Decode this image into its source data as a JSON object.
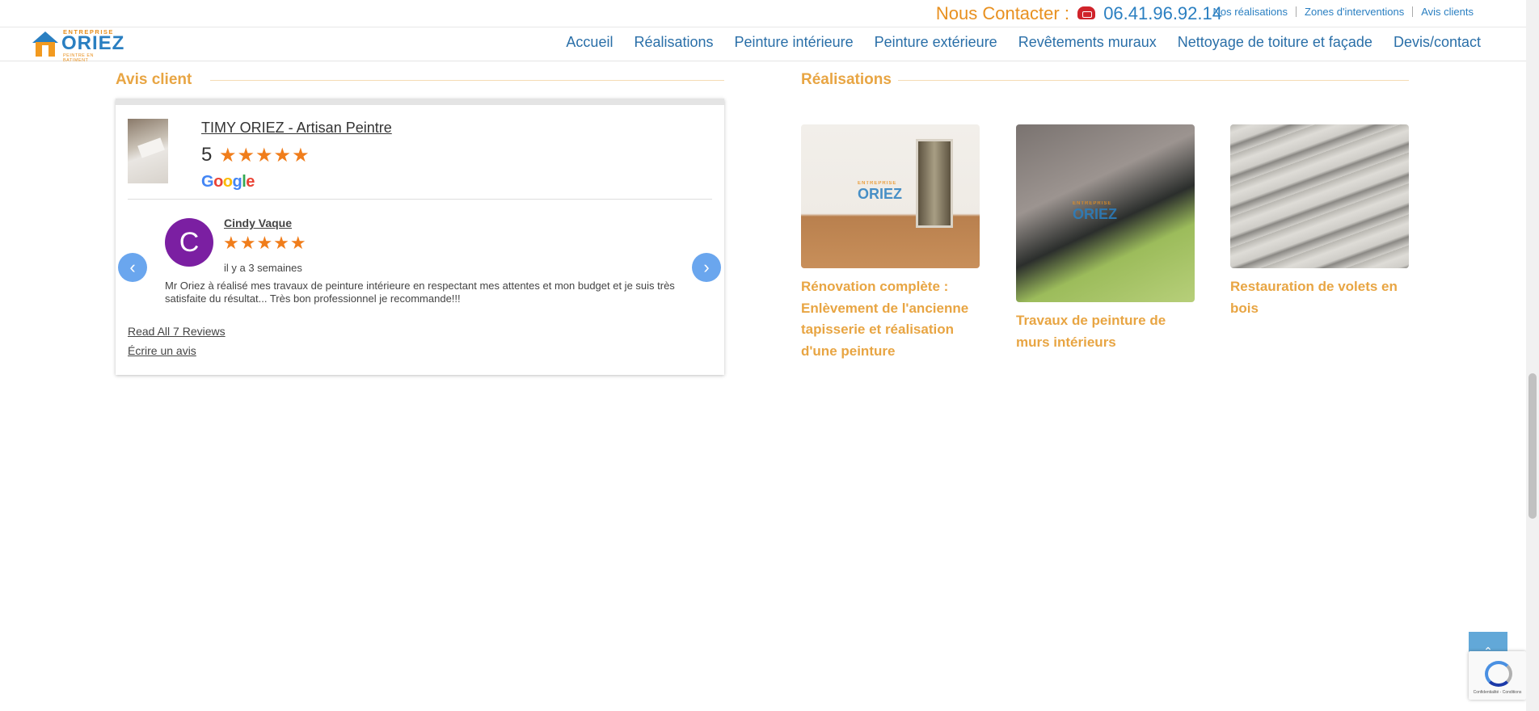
{
  "header": {
    "contact_label": "Nous Contacter :",
    "phone": "06.41.96.92.14",
    "top_links": [
      "Nos réalisations",
      "Zones d'interventions",
      "Avis clients"
    ],
    "logo": {
      "small": "ENTREPRISE",
      "big": "ORIEZ",
      "tag": "PEINTRE EN BATIMENT"
    },
    "nav": [
      "Accueil",
      "Réalisations",
      "Peinture intérieure",
      "Peinture extérieure",
      "Revêtements muraux",
      "Nettoyage de toiture et façade",
      "Devis/contact"
    ]
  },
  "reviews": {
    "section_title": "Avis client",
    "business_name": "TIMY ORIEZ - Artisan Peintre",
    "rating": "5",
    "stars": "★★★★★",
    "google": "Google",
    "review": {
      "avatar_letter": "C",
      "author": "Cindy Vaque",
      "stars": "★★★★★",
      "date": "il y a 3 semaines",
      "text": "Mr Oriez à réalisé mes travaux de peinture intérieure en respectant mes attentes et mon budget et je suis très satisfaite du résultat... Très bon professionnel je recommande!!!"
    },
    "read_all": "Read All 7 Reviews",
    "write": "Écrire un avis"
  },
  "realisations": {
    "section_title": "Réalisations",
    "items": [
      {
        "title": "Rénovation complète : Enlèvement de l'ancienne tapisserie et réalisation d'une peinture"
      },
      {
        "title": "Travaux de peinture de murs intérieurs"
      },
      {
        "title": "Restauration de volets en bois"
      }
    ]
  },
  "recaptcha_text": "Confidentialité - Conditions",
  "colors": {
    "accent_orange": "#e8a543",
    "link_blue": "#2a6fa8",
    "star": "#f07d1b",
    "avatar": "#7b1fa2"
  }
}
